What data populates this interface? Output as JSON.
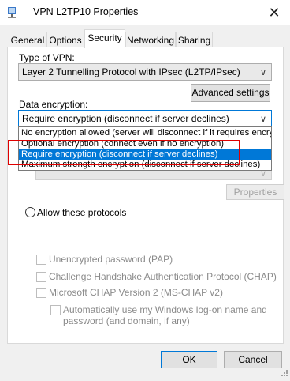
{
  "window": {
    "title": "VPN L2TP10 Properties",
    "close_glyph": "✕"
  },
  "tabs": [
    {
      "label": "General"
    },
    {
      "label": "Options"
    },
    {
      "label": "Security"
    },
    {
      "label": "Networking"
    },
    {
      "label": "Sharing"
    }
  ],
  "security": {
    "vpn_type_label": "Type of VPN:",
    "vpn_type_value": "Layer 2 Tunnelling Protocol with IPsec (L2TP/IPsec)",
    "advanced_button": "Advanced settings",
    "encryption_label": "Data encryption:",
    "encryption_value": "Require encryption (disconnect if server declines)",
    "encryption_options": [
      "No encryption allowed (server will disconnect if it requires encryption",
      "Optional encryption (connect even if no encryption)",
      "Require encryption (disconnect if server declines)",
      "Maximum strength encryption (disconnect if server declines)"
    ],
    "properties_button": "Properties",
    "allow_protocols_label": "Allow these protocols",
    "protocols": [
      {
        "label": "Unencrypted password (PAP)"
      },
      {
        "label": "Challenge Handshake Authentication Protocol (CHAP)"
      },
      {
        "label": "Microsoft CHAP Version 2 (MS-CHAP v2)"
      }
    ],
    "auto_logon_line1": "Automatically use my Windows log-on name and",
    "auto_logon_line2": "password (and domain, if any)"
  },
  "footer": {
    "ok_button": "OK",
    "cancel_button": "Cancel"
  },
  "colors": {
    "accent": "#0078d7",
    "highlight_box": "#e00000"
  }
}
